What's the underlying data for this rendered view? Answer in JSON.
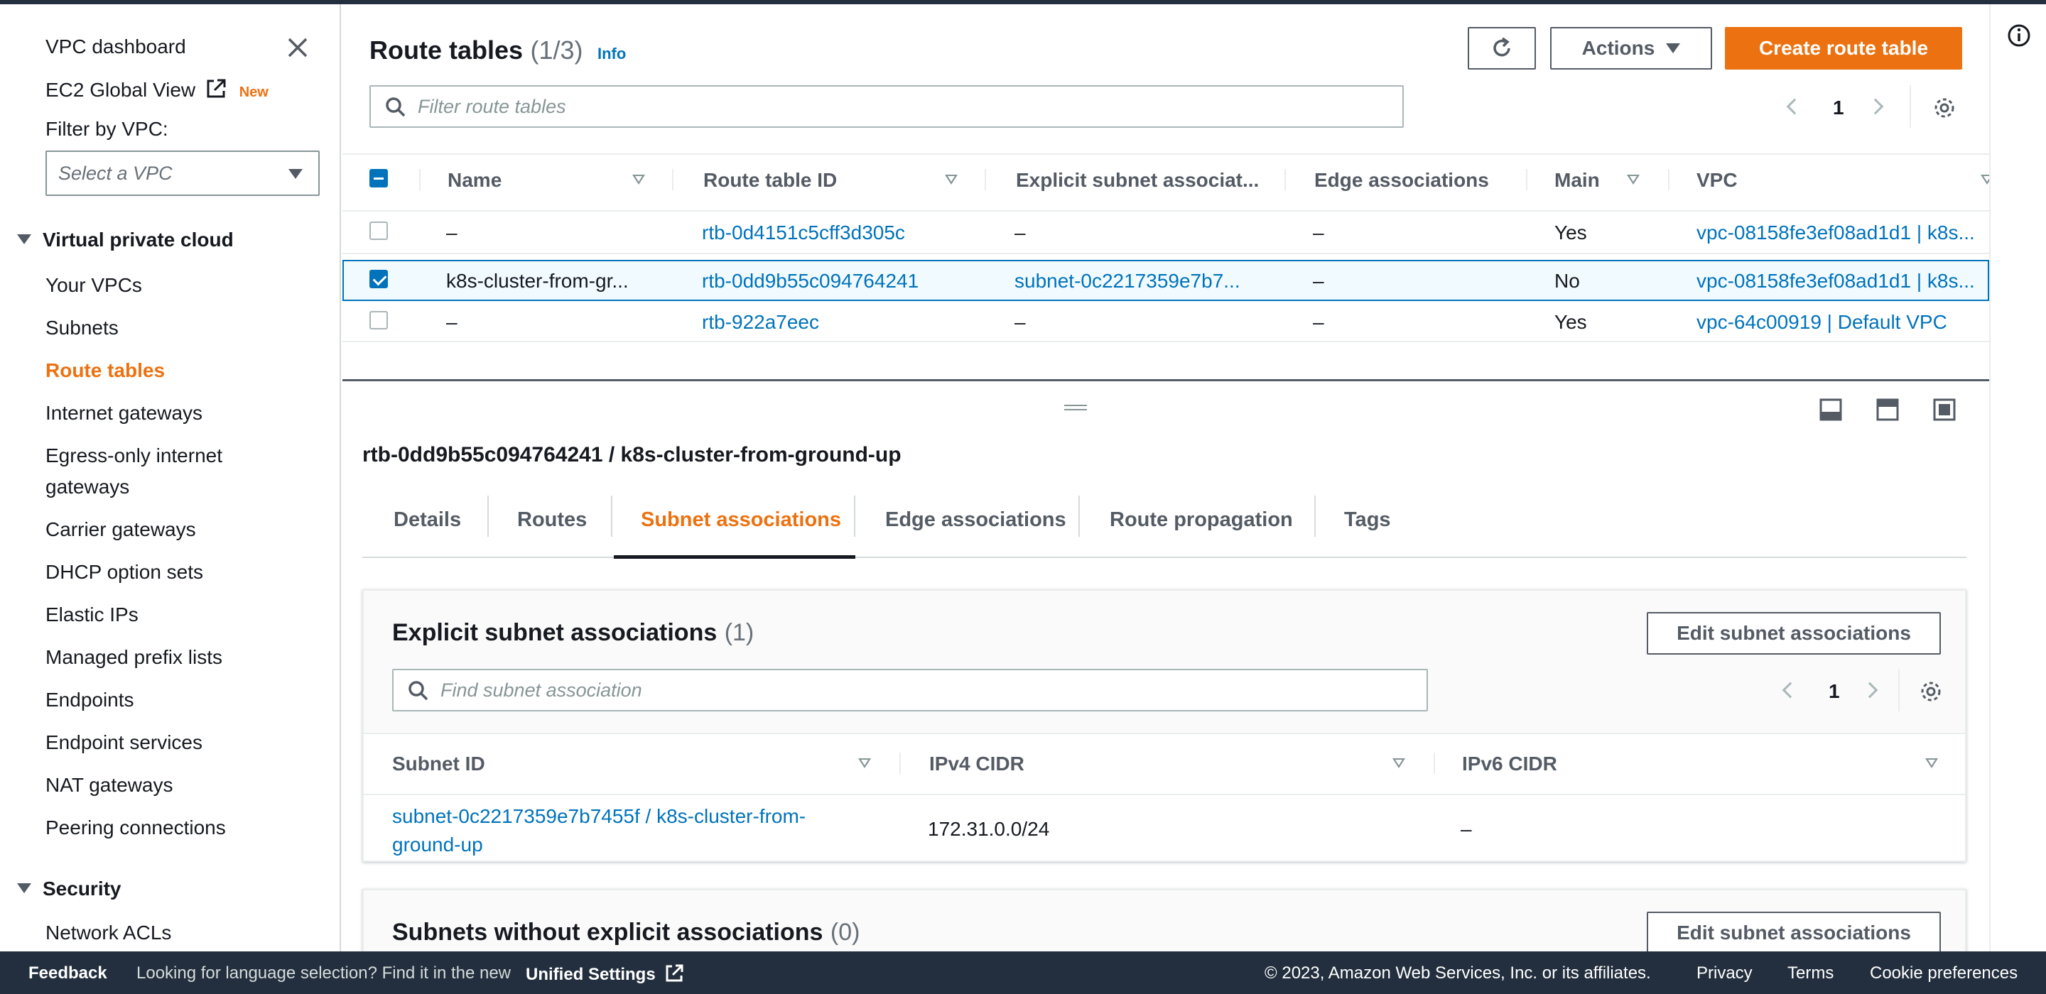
{
  "sidebar": {
    "vpc_dashboard": "VPC dashboard",
    "ec2_global_view": "EC2 Global View",
    "new_badge": "New",
    "filter_label": "Filter by VPC:",
    "filter_placeholder": "Select a VPC",
    "section_vpc": "Virtual private cloud",
    "items": [
      "Your VPCs",
      "Subnets",
      "Route tables",
      "Internet gateways",
      "Egress-only internet",
      "gateways",
      "Carrier gateways",
      "DHCP option sets",
      "Elastic IPs",
      "Managed prefix lists",
      "Endpoints",
      "Endpoint services",
      "NAT gateways",
      "Peering connections"
    ],
    "active_item": "Route tables",
    "section_security": "Security",
    "security_items": [
      "Network ACLs"
    ]
  },
  "header": {
    "title": "Route tables",
    "count": "(1/3)",
    "info": "Info",
    "actions_label": "Actions",
    "create_label": "Create route table",
    "search_placeholder": "Filter route tables",
    "page": "1"
  },
  "table": {
    "columns": [
      "Name",
      "Route table ID",
      "Explicit subnet associat...",
      "Edge associations",
      "Main",
      "VPC"
    ],
    "rows": [
      {
        "selected": false,
        "name": "–",
        "id": "rtb-0d4151c5cff3d305c",
        "explicit": "–",
        "edge": "–",
        "main": "Yes",
        "vpc": "vpc-08158fe3ef08ad1d1 | k8s..."
      },
      {
        "selected": true,
        "name": "k8s-cluster-from-gr...",
        "id": "rtb-0dd9b55c094764241",
        "explicit": "subnet-0c2217359e7b7...",
        "edge": "–",
        "main": "No",
        "vpc": "vpc-08158fe3ef08ad1d1 | k8s..."
      },
      {
        "selected": false,
        "name": "–",
        "id": "rtb-922a7eec",
        "explicit": "–",
        "edge": "–",
        "main": "Yes",
        "vpc": "vpc-64c00919 | Default VPC"
      }
    ]
  },
  "detail": {
    "title": "rtb-0dd9b55c094764241 / k8s-cluster-from-ground-up",
    "tabs": [
      "Details",
      "Routes",
      "Subnet associations",
      "Edge associations",
      "Route propagation",
      "Tags"
    ],
    "active_tab": "Subnet associations",
    "explicit_panel": {
      "title": "Explicit subnet associations",
      "count": "(1)",
      "edit_label": "Edit subnet associations",
      "search_placeholder": "Find subnet association",
      "page": "1",
      "columns": [
        "Subnet ID",
        "IPv4 CIDR",
        "IPv6 CIDR"
      ],
      "rows": [
        {
          "subnet_line1": "subnet-0c2217359e7b7455f / k8s-cluster-from-",
          "subnet_line2": "ground-up",
          "ipv4": "172.31.0.0/24",
          "ipv6": "–"
        }
      ]
    },
    "implicit_panel": {
      "title": "Subnets without explicit associations",
      "count": "(0)",
      "edit_label": "Edit subnet associations"
    }
  },
  "footer": {
    "feedback": "Feedback",
    "language_text": "Looking for language selection? Find it in the new",
    "unified_settings": "Unified Settings",
    "copyright": "© 2023, Amazon Web Services, Inc. or its affiliates.",
    "privacy": "Privacy",
    "terms": "Terms",
    "cookies": "Cookie preferences"
  },
  "colors": {
    "accent": "#ec7211",
    "link": "#0073bb",
    "footer_bg": "#232f3e"
  }
}
